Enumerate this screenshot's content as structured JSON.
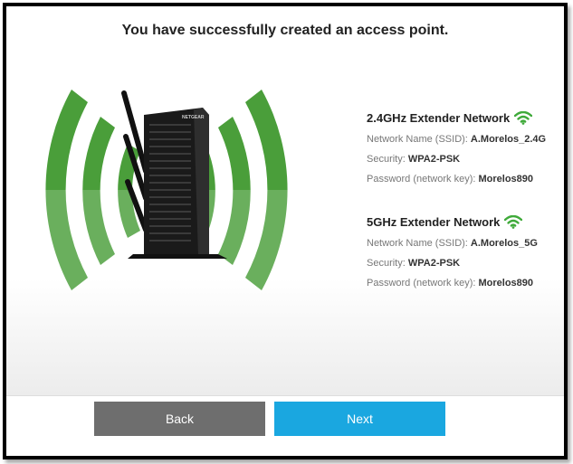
{
  "header": {
    "title": "You have successfully created an access point."
  },
  "networks": [
    {
      "heading": "2.4GHz Extender Network",
      "ssid_label": "Network Name (SSID):",
      "ssid": "A.Morelos_2.4G",
      "security_label": "Security:",
      "security": "WPA2-PSK",
      "password_label": "Password (network key):",
      "password": "Morelos890"
    },
    {
      "heading": "5GHz Extender Network",
      "ssid_label": "Network Name (SSID):",
      "ssid": "A.Morelos_5G",
      "security_label": "Security:",
      "security": "WPA2-PSK",
      "password_label": "Password (network key):",
      "password": "Morelos890"
    }
  ],
  "device": {
    "brand": "NETGEAR"
  },
  "buttons": {
    "back": "Back",
    "next": "Next"
  },
  "colors": {
    "wave_green": "#4a9e3a",
    "wifi_green": "#3faa3a",
    "next_blue": "#1aa7e0",
    "back_gray": "#6e6e6e"
  },
  "icons": {
    "wifi": "wifi-icon"
  }
}
